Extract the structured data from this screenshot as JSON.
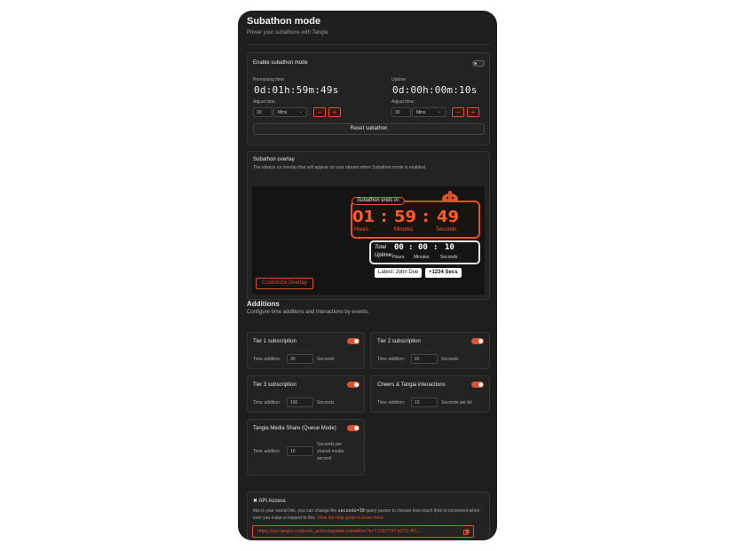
{
  "header": {
    "title": "Subathon mode",
    "subtitle": "Power your subathons with Tangia"
  },
  "settings": {
    "enable_label": "Enable subathon mode",
    "enable_on": false,
    "remaining": {
      "label": "Remaining time:",
      "value": "0d:01h:59m:49s",
      "adjust_label": "Adjust time:",
      "adjust_value": "30",
      "unit": "Mins"
    },
    "uptime": {
      "label": "Uptime:",
      "value": "0d:00h:00m:10s",
      "adjust_label": "Adjust time:",
      "adjust_value": "30",
      "unit": "Mins"
    },
    "minus": "−",
    "plus": "+",
    "reset_label": "Reset subathon"
  },
  "overlay": {
    "title": "Subathon overlay",
    "description": "The always on overlay that will appear on your stream when Subathon mode is enabled.",
    "ends_in": "Subathon ends in:",
    "hours": "01",
    "minutes": "59",
    "seconds": "49",
    "hours_label": "Hours",
    "minutes_label": "Minutes",
    "seconds_label": "Seconds",
    "total_label": "Total Uptime:",
    "up_hours": "00",
    "up_minutes": "00",
    "up_seconds": "10",
    "up_hours_label": "Hours",
    "up_minutes_label": "Minutes",
    "up_seconds_label": "Seconds",
    "latest": "Latest: John Doe",
    "added": "+1234 Secs",
    "customize_label": "Customize Overlay",
    "accent": "#ff5a28"
  },
  "additions": {
    "title": "Additions",
    "subtitle": "Configure time additions and interactions by events.",
    "time_label": "Time addition:",
    "items": [
      {
        "name": "Tier 1 subscription",
        "value": "30",
        "unit": "Seconds",
        "on": true
      },
      {
        "name": "Tier 2 subscription",
        "value": "60",
        "unit": "Seconds",
        "on": true
      },
      {
        "name": "Tier 3 subscription",
        "value": "100",
        "unit": "Seconds",
        "on": true
      },
      {
        "name": "Cheers & Tangia interactions",
        "value": "10",
        "unit": "Seconds per bit",
        "on": true
      },
      {
        "name": "Tangia Media Share (Queue Mode)",
        "value": "10",
        "unit": "Seconds per shared media second",
        "on": true
      }
    ]
  },
  "api": {
    "title": "API Access",
    "desc_1": "this is your secret link, you can change the",
    "param": "seconds=30",
    "desc_2": "query param to choose how much time to increment when ever you make a request to this.",
    "help_link": "View the help guide to learn more.",
    "url": "https://api.tangia.co/quick_action/update-subathon?k=712b7737-b372-4f1..."
  }
}
